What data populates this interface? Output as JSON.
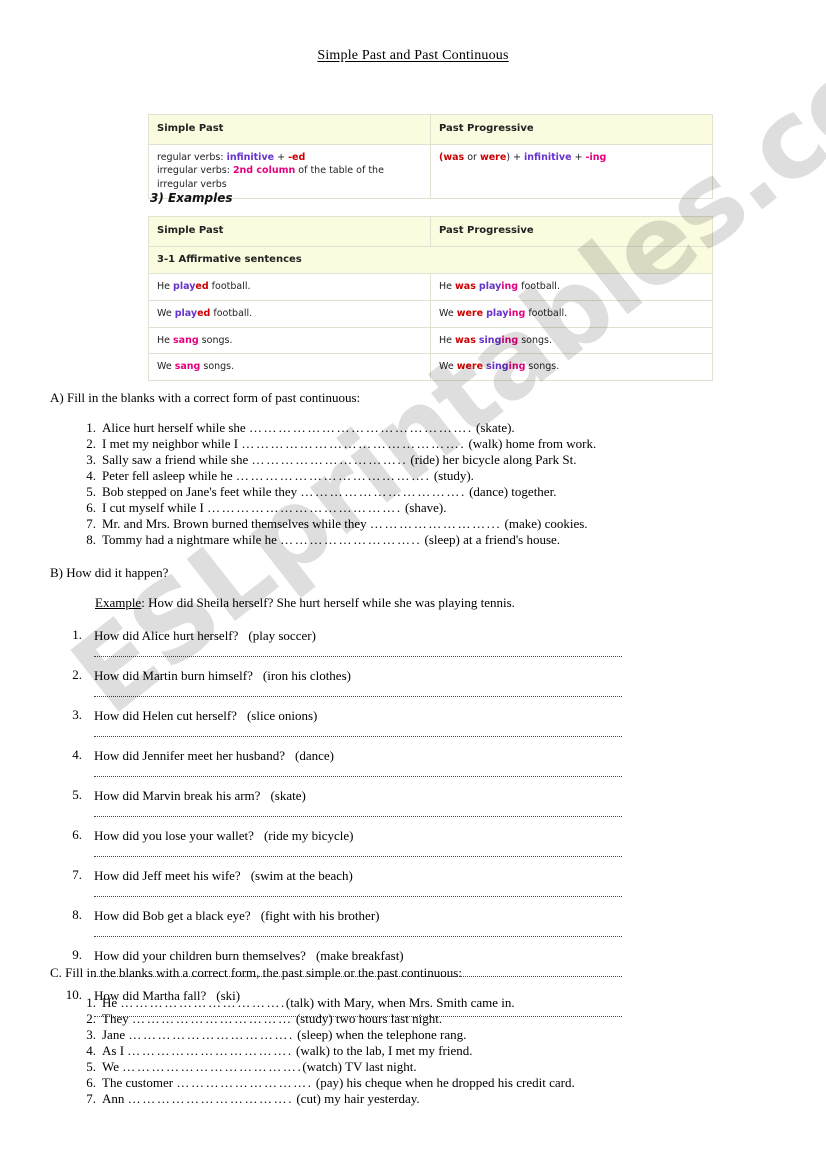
{
  "document": {
    "title": "Simple Past and Past Continuous",
    "watermark": "ESLprintables.com"
  },
  "grammar": {
    "table1": {
      "headers": [
        "Simple Past",
        "Past Progressive"
      ],
      "left_line1_prefix": "regular verbs: ",
      "left_line1_infinitive": "infinitive",
      "left_line1_plus": " + ",
      "left_line1_ed": "-ed",
      "left_line2_prefix": "irregular verbs: ",
      "left_line2_col": "2nd column",
      "left_line2_rest": " of the table of the irregular verbs",
      "right_open": "(",
      "right_was": "was",
      "right_or": " or ",
      "right_were": "were",
      "right_close": ") + ",
      "right_infinitive": "infinitive",
      "right_plus": " + ",
      "right_ing": "-ing"
    },
    "examples_heading": "3) Examples",
    "table2": {
      "headers": [
        "Simple Past",
        "Past Progressive"
      ],
      "subheader": "3-1 Affirmative sentences",
      "rows": [
        {
          "left": {
            "pre": "He ",
            "stem": "play",
            "suffix": "ed",
            "post": " football."
          },
          "right": {
            "pre": "He ",
            "aux": "was",
            "sp": " ",
            "stem": "play",
            "suffix": "ing",
            "post": " football."
          }
        },
        {
          "left": {
            "pre": "We ",
            "stem": "play",
            "suffix": "ed",
            "post": " football."
          },
          "right": {
            "pre": "We ",
            "aux": "were",
            "sp": " ",
            "stem": "play",
            "suffix": "ing",
            "post": " football."
          }
        },
        {
          "left": {
            "pre": "He ",
            "stem": "sang",
            "suffix": "",
            "post": " songs."
          },
          "right": {
            "pre": "He ",
            "aux": "was",
            "sp": " ",
            "stem": "sing",
            "suffix": "ing",
            "post": " songs."
          }
        },
        {
          "left": {
            "pre": "We ",
            "stem": "sang",
            "suffix": "",
            "post": " songs."
          },
          "right": {
            "pre": "We ",
            "aux": "were",
            "sp": " ",
            "stem": "sing",
            "suffix": "ing",
            "post": " songs."
          }
        }
      ]
    }
  },
  "section_a": {
    "heading": "A) Fill in the blanks with a correct form of past continuous:",
    "items": [
      {
        "num": "1.",
        "before": "Alice hurt herself while she ",
        "dots": "……………………………………….",
        "after": " (skate)."
      },
      {
        "num": "2.",
        "before": "I met my neighbor while I ",
        "dots": "……………………………………….",
        "after": " (walk) home from work."
      },
      {
        "num": "3.",
        "before": "Sally saw a friend while she ",
        "dots": "…………………………..",
        "after": " (ride) her bicycle along Park St."
      },
      {
        "num": "4.",
        "before": "Peter fell asleep while he ",
        "dots": "………………………………….",
        "after": " (study)."
      },
      {
        "num": "5.",
        "before": "Bob stepped on Jane's feet while they ",
        "dots": "…………………………….",
        "after": " (dance) together."
      },
      {
        "num": "6.",
        "before": "I cut myself while I ",
        "dots": "………………………………….",
        "after": " (shave)."
      },
      {
        "num": "7.",
        "before": "Mr. and Mrs. Brown burned themselves while they ",
        "dots": "……………………...",
        "after": " (make) cookies."
      },
      {
        "num": "8.",
        "before": "Tommy had a nightmare while he ",
        "dots": "………………………..",
        "after": " (sleep) at a friend's house."
      }
    ]
  },
  "section_b": {
    "heading": "B) How did it happen?",
    "example_label": "Example",
    "example_text": ": How did Sheila herself? She hurt herself while she was playing tennis.",
    "items": [
      {
        "num": "1.",
        "question": "How did Alice hurt herself?",
        "cue": "(play soccer)"
      },
      {
        "num": "2.",
        "question": "How did Martin burn himself?",
        "cue": "(iron his clothes)"
      },
      {
        "num": "3.",
        "question": "How did Helen cut herself?",
        "cue": "(slice onions)"
      },
      {
        "num": "4.",
        "question": "How did Jennifer meet her husband?",
        "cue": "(dance)"
      },
      {
        "num": "5.",
        "question": "How did Marvin break his arm?",
        "cue": "(skate)"
      },
      {
        "num": "6.",
        "question": "How did you lose your wallet?",
        "cue": "(ride my bicycle)"
      },
      {
        "num": "7.",
        "question": "How did Jeff meet his wife?",
        "cue": "(swim at the beach)"
      },
      {
        "num": "8.",
        "question": "How did Bob get a black eye?",
        "cue": "(fight with his brother)"
      },
      {
        "num": "9.",
        "question": "How did your children burn themselves?",
        "cue": "(make breakfast)"
      },
      {
        "num": "10.",
        "question": "How did Martha fall?",
        "cue": "(ski)"
      }
    ]
  },
  "section_c": {
    "heading": "C. Fill in the blanks with a correct form, the past simple or the past continuous:",
    "items": [
      {
        "num": "1.",
        "before": "He ",
        "dots": "…………………………….",
        "after": "(talk) with Mary, when Mrs. Smith came in."
      },
      {
        "num": "2.",
        "before": "They ",
        "dots": "……………………………",
        "after": " (study) two hours last night."
      },
      {
        "num": "3.",
        "before": "Jane ",
        "dots": "…………………………….",
        "after": " (sleep) when the telephone rang."
      },
      {
        "num": "4.",
        "before": "As I ",
        "dots": "…………………………….",
        "after": " (walk) to the lab, I met my friend."
      },
      {
        "num": "5.",
        "before": "We ",
        "dots": "……………………………….",
        "after": "(watch) TV last night."
      },
      {
        "num": "6.",
        "before": "The customer ",
        "dots": "……………………….",
        "after": " (pay) his cheque when he dropped his credit card."
      },
      {
        "num": "7.",
        "before": "Ann ",
        "dots": "…………………………….",
        "after": " (cut) my hair yesterday."
      }
    ]
  }
}
